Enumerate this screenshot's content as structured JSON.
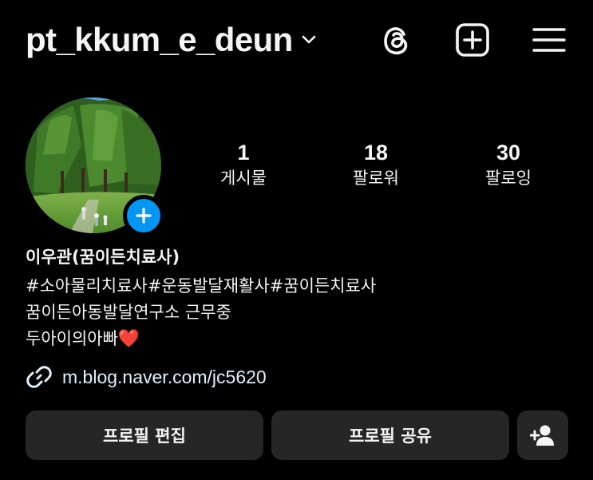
{
  "header": {
    "username": "pt_kkum_e_deun",
    "icons": {
      "dropdown": "chevron-down-icon",
      "threads": "threads-icon",
      "create": "plus-square-icon",
      "menu": "hamburger-menu-icon"
    }
  },
  "profile": {
    "avatar_icon": "avatar",
    "add_story_icon": "plus-icon",
    "stats": [
      {
        "value": "1",
        "label": "게시물"
      },
      {
        "value": "18",
        "label": "팔로워"
      },
      {
        "value": "30",
        "label": "팔로잉"
      }
    ],
    "name": "이우관(꿈이든치료사)",
    "bio_lines": [
      "#소아물리치료사#운동발달재활사#꿈이든치료사",
      "꿈이든아동발달연구소 근무중",
      "두아이의아빠"
    ],
    "bio_emoji": "❤️",
    "link": "m.blog.naver.com/jc5620"
  },
  "actions": {
    "edit_label": "프로필 편집",
    "share_label": "프로필 공유",
    "suggest_icon": "add-person-icon"
  },
  "colors": {
    "background": "#000000",
    "text": "#f5f5f5",
    "button": "#262626",
    "accent": "#0095f6",
    "link": "#e0f1ff",
    "heart": "#e8283a"
  }
}
